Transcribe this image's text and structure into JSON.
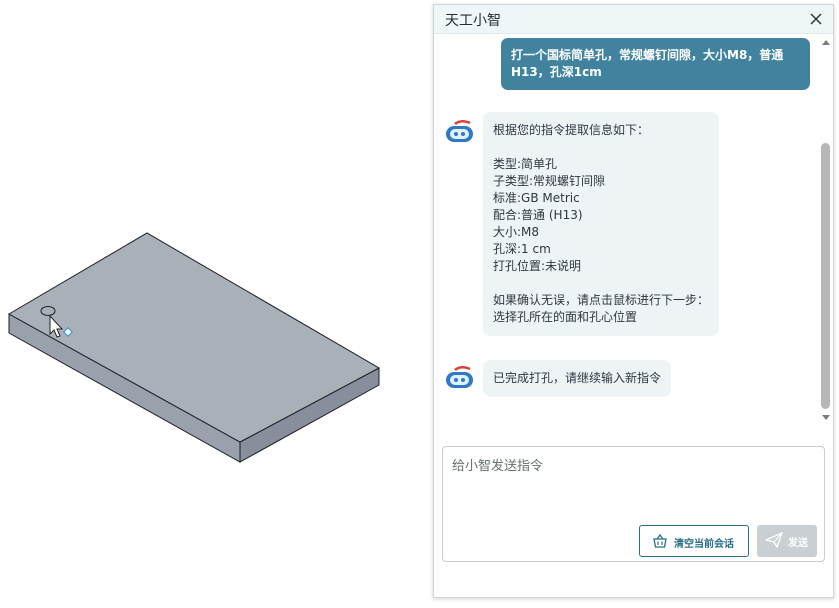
{
  "panel": {
    "title": "天工小智"
  },
  "chat": {
    "user_message": "打一个国标简单孔，常规螺钉间隙，大小M8，普通H13，孔深1cm",
    "bot_reply_1": {
      "lines": [
        "根据您的指令提取信息如下：",
        "",
        "类型:简单孔",
        "子类型:常规螺钉间隙",
        "标准:GB Metric",
        "配合:普通 (H13)",
        "大小:M8",
        "孔深:1 cm",
        "打孔位置:未说明",
        "",
        "如果确认无误，请点击鼠标进行下一步：",
        "选择孔所在的面和孔心位置"
      ]
    },
    "bot_reply_2": "已完成打孔，请继续输入新指令"
  },
  "composer": {
    "placeholder": "给小智发送指令",
    "value": "",
    "clear_label": "清空当前会话",
    "send_label": "发送"
  },
  "colors": {
    "user_bubble": "#41839e",
    "bot_bubble": "#eef3f6",
    "header_bg": "#eef6f7",
    "plate_top": "#a9b0b8",
    "send_disabled": "#c9cfd2"
  },
  "icons": {
    "close": "close-icon",
    "avatar": "robot-avatar-icon",
    "clear": "basket-icon",
    "send": "paper-plane-icon"
  }
}
